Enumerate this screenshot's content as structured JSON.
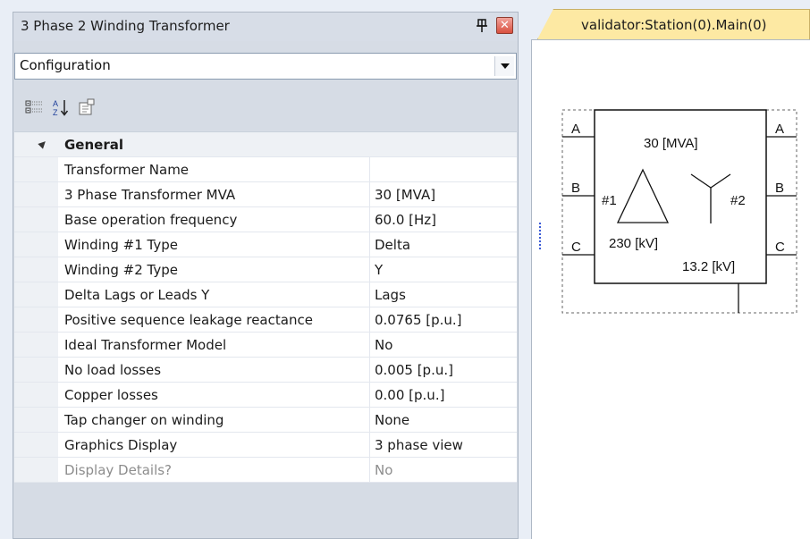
{
  "panel": {
    "title": "3 Phase 2 Winding Transformer",
    "pin_icon": "pin-icon",
    "close_icon": "close-icon",
    "configuration": "Configuration"
  },
  "toolbar": {
    "icons": [
      "categorized-icon",
      "alphabetical-sort-icon",
      "property-pages-icon"
    ]
  },
  "grid": {
    "category": "General",
    "rows": [
      {
        "name": "Transformer Name",
        "value": ""
      },
      {
        "name": "3 Phase Transformer MVA",
        "value": "30 [MVA]"
      },
      {
        "name": "Base operation frequency",
        "value": "60.0 [Hz]"
      },
      {
        "name": "Winding #1 Type",
        "value": "Delta"
      },
      {
        "name": "Winding #2 Type",
        "value": "Y"
      },
      {
        "name": "Delta Lags or Leads Y",
        "value": "Lags"
      },
      {
        "name": "Positive sequence leakage reactance",
        "value": "0.0765 [p.u.]"
      },
      {
        "name": "Ideal Transformer Model",
        "value": "No"
      },
      {
        "name": "No load losses",
        "value": "0.005 [p.u.]"
      },
      {
        "name": "Copper losses",
        "value": "0.00 [p.u.]"
      },
      {
        "name": "Tap changer on winding",
        "value": "None"
      },
      {
        "name": "Graphics Display",
        "value": "3 phase view"
      },
      {
        "name": "Display Details?",
        "value": "No",
        "disabled": true
      }
    ]
  },
  "document_tab": {
    "label": "validator:Station(0).Main(0)"
  },
  "schematic": {
    "rating": "30 [MVA]",
    "winding1": "#1",
    "winding2": "#2",
    "voltage1": "230 [kV]",
    "voltage2": "13.2 [kV]",
    "left_phases": [
      "A",
      "B",
      "C"
    ],
    "right_phases": [
      "A",
      "B",
      "C"
    ]
  }
}
